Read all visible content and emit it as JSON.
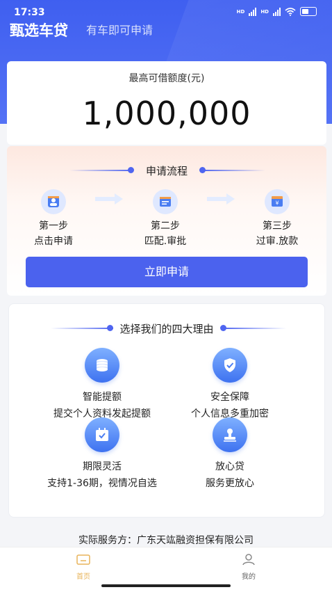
{
  "status_bar": {
    "time": "17:33",
    "signal1": "HD",
    "signal2": "HD"
  },
  "header": {
    "brand": "甄选车贷",
    "slogan": "有车即可申请",
    "accent": "#4b62ee"
  },
  "amount": {
    "label": "最高可借额度(元)",
    "value": "1,000,000"
  },
  "process": {
    "title": "申请流程",
    "steps": [
      {
        "name": "第一步",
        "desc": "点击申请",
        "icon": "user-card-icon"
      },
      {
        "name": "第二步",
        "desc": "匹配.审批",
        "icon": "document-icon"
      },
      {
        "name": "第三步",
        "desc": "过审.放款",
        "icon": "wallet-yen-icon"
      }
    ]
  },
  "apply_button": {
    "label": "立即申请"
  },
  "reasons": {
    "title": "选择我们的四大理由",
    "items": [
      {
        "title": "智能提额",
        "desc": "提交个人资料发起提额",
        "icon": "coins-stack-icon"
      },
      {
        "title": "安全保障",
        "desc": "个人信息多重加密",
        "icon": "shield-check-icon"
      },
      {
        "title": "期限灵活",
        "desc": "支持1-36期，视情况自选",
        "icon": "calendar-check-icon"
      },
      {
        "title": "放心贷",
        "desc": "服务更放心",
        "icon": "stamp-icon"
      }
    ]
  },
  "provider": {
    "text": "实际服务方：广东天竑融资担保有限公司"
  },
  "tabbar": {
    "items": [
      {
        "label": "首页",
        "active": true,
        "icon": "home-icon",
        "color": "#e8b45a"
      },
      {
        "label": "我的",
        "active": false,
        "icon": "user-icon",
        "color": "#666666"
      }
    ]
  }
}
